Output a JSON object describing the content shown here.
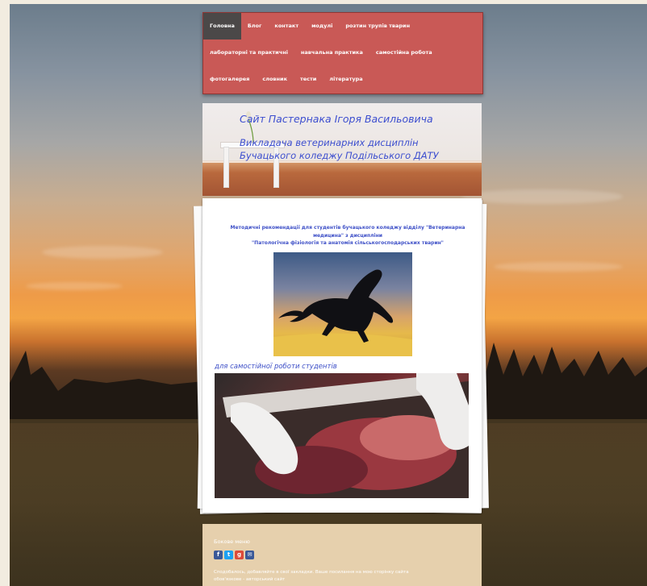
{
  "nav": {
    "row1": [
      "Головна",
      "Блог",
      "контакт",
      "модулі",
      "розтин трупів тварин"
    ],
    "row2": [
      "лабораторні та практичні",
      "навчальна практика",
      "самостійна робота"
    ],
    "row3": [
      "фотогалерея",
      "словник",
      "тести",
      "література"
    ]
  },
  "banner": {
    "line1": "Сайт Пастернака Ігоря Васильовича",
    "line2": "Викладача ветеринарних дисциплін",
    "line3": "Бучацького коледжу Подільського ДАТУ"
  },
  "content": {
    "intro_line1": "Методичні рекомендації для студентів бучацького коледжу  відділу \"Ветеринарна",
    "intro_line2": "медицина\" з дисципліни",
    "intro_line3": "\"Патологічна фізіологія та анатомія сільськогосподарських тварин\"",
    "caption": "для самостійної роботи студентів"
  },
  "footer": {
    "title": "Бокове меню",
    "icons": [
      {
        "name": "facebook-icon",
        "glyph": "f",
        "color": "#3b5998"
      },
      {
        "name": "twitter-icon",
        "glyph": "t",
        "color": "#1da1f2"
      },
      {
        "name": "googleplus-icon",
        "glyph": "g",
        "color": "#dd4b39"
      },
      {
        "name": "email-icon",
        "glyph": "✉",
        "color": "#3b5998"
      }
    ],
    "text_line1": "Сподобалось, добавляйте в свої закладки. Ваше посилання на мою сторінку сайта",
    "text_line2": "обов'язкове - авторський сайт"
  }
}
